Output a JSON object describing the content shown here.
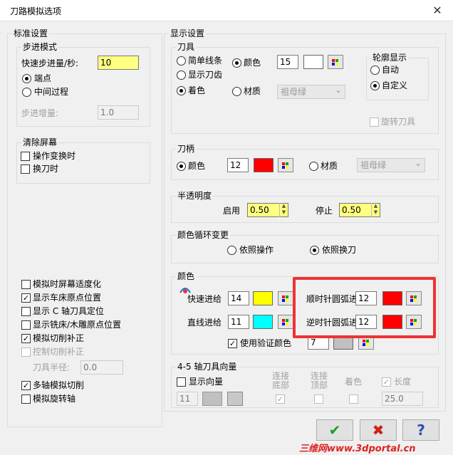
{
  "window": {
    "title": "刀路模拟选项",
    "close": "✕"
  },
  "std": {
    "caption": "标准设置",
    "step": {
      "caption": "步进模式",
      "fast_label": "快速步进量/秒:",
      "fast_value": "10",
      "endpoint": "端点",
      "middle": "中间过程",
      "inc_label": "步进增量:",
      "inc_value": "1.0"
    },
    "clear": {
      "caption": "清除屏幕",
      "op_change": "操作变换时",
      "tool_change": "换刀时"
    },
    "opts": {
      "fit": "模拟时屏幕适度化",
      "lathe_origin": "显示车床原点位置",
      "c_axis": "显示 C 轴刀具定位",
      "mill_origin": "显示铣床/木雕原点位置",
      "cut_comp": "模拟切削补正",
      "ctrl_comp": "控制切削补正",
      "radius_label": "刀具半径:",
      "radius_value": "0.0",
      "multi_axis": "多轴模拟切削",
      "rotary": "模拟旋转轴"
    }
  },
  "disp": {
    "caption": "显示设置",
    "tool": {
      "caption": "刀具",
      "simple": "简单线条",
      "show_edge": "显示刀齿",
      "shade": "着色",
      "color": "颜色",
      "material": "材质",
      "color_num": "15",
      "material_value": "祖母绿"
    },
    "contour": {
      "caption": "轮廓显示",
      "auto": "自动",
      "custom": "自定义",
      "rotate": "旋转刀具"
    },
    "holder": {
      "caption": "刀柄",
      "color": "颜色",
      "color_num": "12",
      "material": "材质",
      "material_value": "祖母绿"
    },
    "trans": {
      "caption": "半透明度",
      "start_label": "启用",
      "start_value": "0.50",
      "stop_label": "停止",
      "stop_value": "0.50"
    },
    "cycle": {
      "caption": "颜色循环变更",
      "by_op": "依照操作",
      "by_tool": "依照换刀"
    },
    "colors": {
      "caption": "颜色",
      "rapid_label": "快速进给",
      "rapid": "14",
      "linear_label": "直线进给",
      "linear": "11",
      "cw_label": "顺时针圆弧进给",
      "cw": "12",
      "ccw_label": "逆时针圆弧进给",
      "ccw": "12",
      "verify_label": "使用验证颜色",
      "verify": "7"
    },
    "axis45": {
      "caption": "4-5 轴刀具向量",
      "show_vec": "显示向量",
      "vec_num": "11",
      "link_bottom": "连接底部",
      "link_top": "连接顶部",
      "shade": "着色",
      "length": "长度",
      "length_value": "25.0"
    }
  },
  "buttons": {
    "ok": "✔",
    "cancel": "✖",
    "help": "?"
  },
  "watermark": "三维网www.3dportal.cn",
  "colors": {
    "yellow": "#ffff80",
    "red": "#ff0000",
    "cyan": "#00ffff",
    "yellow_swatch": "#ffff00",
    "gray": "#c0c0c0",
    "highlight": "#e33333"
  }
}
